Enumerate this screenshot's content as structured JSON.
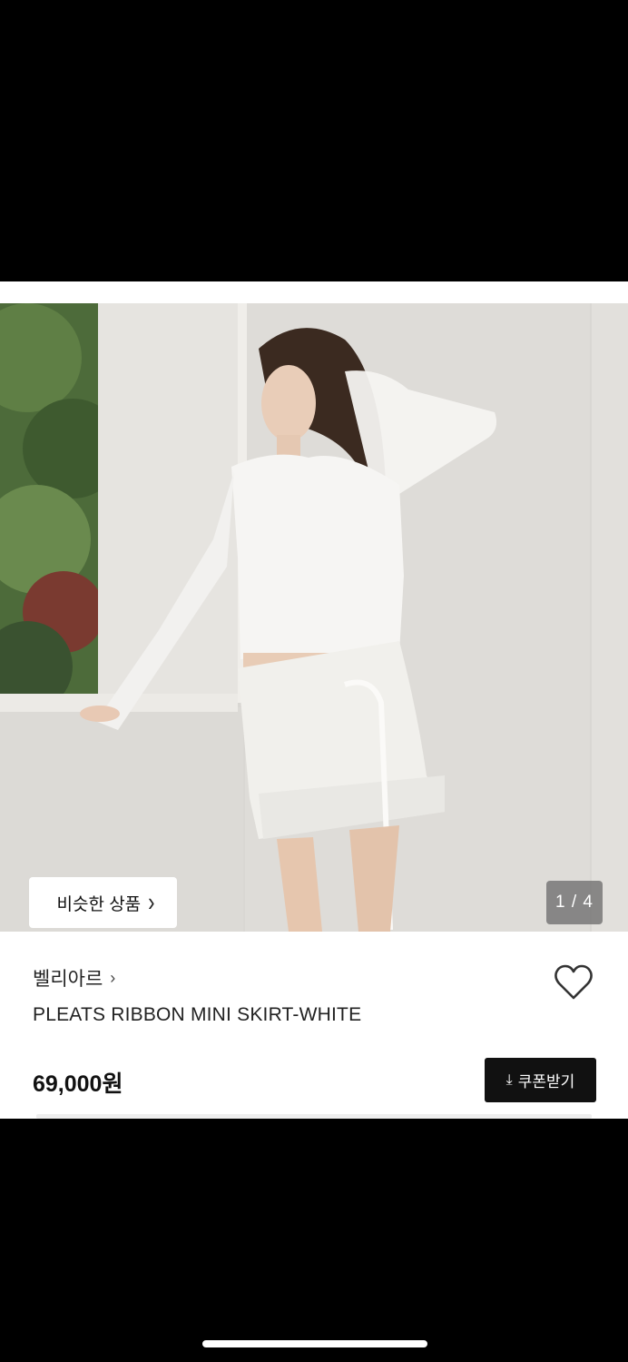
{
  "product": {
    "similar_label": "비슷한 상품",
    "image_index": "1 / 4",
    "brand": "벨리아르",
    "name": "PLEATS RIBBON MINI SKIRT-WHITE",
    "price": "69,000원",
    "coupon_label": "쿠폰받기"
  },
  "icons": {
    "heart": "heart-outline-icon",
    "download": "download-icon",
    "chevron": "chevron-right-icon"
  },
  "colors": {
    "background": "#000000",
    "card": "#ffffff",
    "button_dark": "#111111",
    "indicator_bg": "#6e6e6e"
  }
}
